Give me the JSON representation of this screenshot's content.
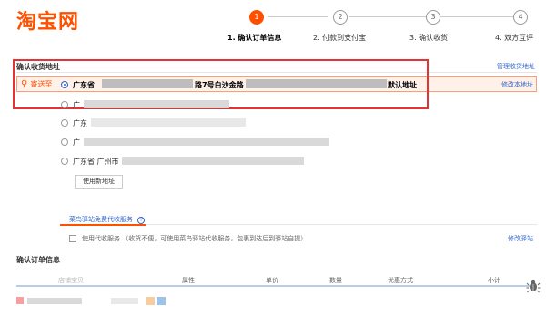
{
  "logo": "淘宝网",
  "steps": [
    {
      "num": "1",
      "label": "1. 确认订单信息",
      "active": true
    },
    {
      "num": "2",
      "label": "2. 付款到支付宝",
      "active": false
    },
    {
      "num": "3",
      "label": "3. 确认收货",
      "active": false
    },
    {
      "num": "4",
      "label": "4. 双方互评",
      "active": false
    }
  ],
  "address_section": {
    "title": "确认收货地址",
    "manage_link": "管理收货地址",
    "send_to_label": "寄送至",
    "selected_address": {
      "prefix": "广东省",
      "mid": "路7号白沙金路",
      "default_tag": "默认地址",
      "edit_link": "修改本地址"
    },
    "other_addresses": [
      {
        "prefix": "广"
      },
      {
        "prefix": "广东"
      },
      {
        "prefix": "广"
      },
      {
        "prefix": "广东省 广州市"
      }
    ],
    "new_address_button": "使用新地址"
  },
  "cainiao": {
    "tab_label": "菜鸟驿站免费代收服务",
    "help_icon_text": "?",
    "checkbox_label": "使用代收服务 （收货不便，可使用菜鸟驿站代收服务，包裹到达后到驿站自提）",
    "modify_link": "修改驿站"
  },
  "order_section": {
    "title": "确认订单信息",
    "columns": [
      "店铺宝贝",
      "属性",
      "单价",
      "数量",
      "优惠方式",
      "小计"
    ]
  },
  "colors": {
    "brand": "#ff5000",
    "link": "#3366cc",
    "highlight_border": "#e53333"
  }
}
